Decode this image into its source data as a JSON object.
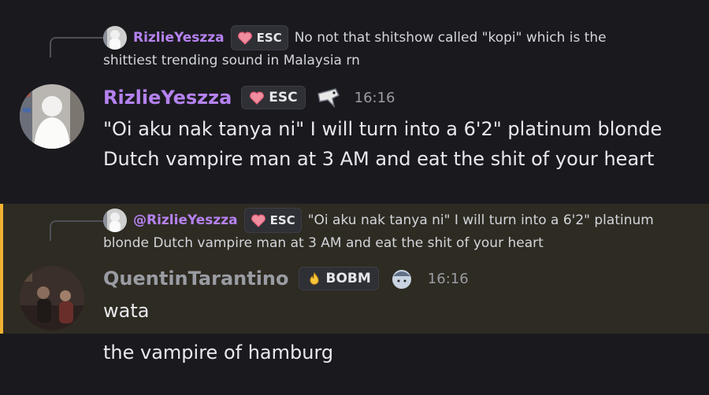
{
  "messages": [
    {
      "reply": {
        "author": "RizlieYeszza",
        "tag": "ESC",
        "text_line1": "No not that shitshow called \"kopi\" which is the",
        "text_line2": "shittiest trending sound in Malaysia rn"
      },
      "author": "RizlieYeszza",
      "tag": "ESC",
      "time": "16:16",
      "lines": [
        "\"Oi aku nak tanya ni\" I will turn into a 6'2\" platinum blonde",
        "Dutch vampire man at 3 AM and eat the shit of your heart"
      ]
    },
    {
      "reply": {
        "author": "@RizlieYeszza",
        "tag": "ESC",
        "text_line1": "\"Oi aku nak tanya ni\" I will turn into a 6'2\" platinum",
        "text_line2": "blonde Dutch vampire man at 3 AM and eat the shit of your heart"
      },
      "author": "QuentinTarantino",
      "tag": "BOBM",
      "time": "16:16",
      "lines": [
        "wata"
      ]
    }
  ],
  "followup": "the vampire of hamburg",
  "colors": {
    "accent_purple": "#b582f0",
    "author_gray": "#9a9ca3",
    "mention_bar": "#f0b232",
    "mention_bg": "#2e2b23"
  },
  "icons": [
    "heart-icon",
    "fire-icon",
    "bird-badge-icon",
    "cap-badge-icon"
  ]
}
